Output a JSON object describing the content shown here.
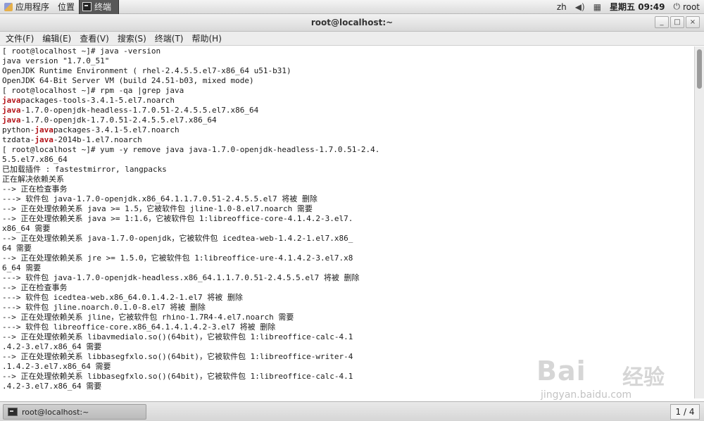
{
  "top_panel": {
    "applications": "应用程序",
    "places": "位置",
    "task_title": "终端",
    "input_method": "zh",
    "datetime": "星期五 09:49",
    "user": "root"
  },
  "window": {
    "title": "root@localhost:~",
    "minimize": "_",
    "maximize": "□",
    "close": "×"
  },
  "menu": [
    "文件(F)",
    "编辑(E)",
    "查看(V)",
    "搜索(S)",
    "终端(T)",
    "帮助(H)"
  ],
  "terminal": {
    "lines": [
      [
        {
          "t": "[ root@localhost ~]# java -version"
        }
      ],
      [
        {
          "t": "java version \"1.7.0_51\""
        }
      ],
      [
        {
          "t": "OpenJDK Runtime Environment ( rhel-2.4.5.5.el7-x86_64 u51-b31)"
        }
      ],
      [
        {
          "t": "OpenJDK 64-Bit Server VM (build 24.51-b03, mixed mode)"
        }
      ],
      [
        {
          "t": "[ root@localhost ~]# rpm -qa |grep java"
        }
      ],
      [
        {
          "t": "java",
          "h": true
        },
        {
          "t": "packages-tools-3.4.1-5.el7.noarch"
        }
      ],
      [
        {
          "t": "java",
          "h": true
        },
        {
          "t": "-1.7.0-openjdk-headless-1.7.0.51-2.4.5.5.el7.x86_64"
        }
      ],
      [
        {
          "t": "java",
          "h": true
        },
        {
          "t": "-1.7.0-openjdk-1.7.0.51-2.4.5.5.el7.x86_64"
        }
      ],
      [
        {
          "t": "python-"
        },
        {
          "t": "java",
          "h": true
        },
        {
          "t": "packages-3.4.1-5.el7.noarch"
        }
      ],
      [
        {
          "t": "tzdata-"
        },
        {
          "t": "java",
          "h": true
        },
        {
          "t": "-2014b-1.el7.noarch"
        }
      ],
      [
        {
          "t": "[ root@localhost ~]# yum -y remove java java-1.7.0-openjdk-headless-1.7.0.51-2.4."
        }
      ],
      [
        {
          "t": "5.5.el7.x86_64"
        }
      ],
      [
        {
          "t": "已加载插件 : fastestmirror, langpacks"
        }
      ],
      [
        {
          "t": "正在解决依赖关系"
        }
      ],
      [
        {
          "t": "--> 正在检查事务"
        }
      ],
      [
        {
          "t": "---> 软件包 java-1.7.0-openjdk.x86_64.1.1.7.0.51-2.4.5.5.el7 将被 删除"
        }
      ],
      [
        {
          "t": "--> 正在处理依赖关系 java >= 1.5，它被软件包 jline-1.0-8.el7.noarch 需要"
        }
      ],
      [
        {
          "t": "--> 正在处理依赖关系 java >= 1:1.6，它被软件包 1:libreoffice-core-4.1.4.2-3.el7."
        }
      ],
      [
        {
          "t": "x86_64 需要"
        }
      ],
      [
        {
          "t": "--> 正在处理依赖关系 java-1.7.0-openjdk，它被软件包 icedtea-web-1.4.2-1.el7.x86_"
        }
      ],
      [
        {
          "t": "64 需要"
        }
      ],
      [
        {
          "t": "--> 正在处理依赖关系 jre >= 1.5.0，它被软件包 1:libreoffice-ure-4.1.4.2-3.el7.x8"
        }
      ],
      [
        {
          "t": "6_64 需要"
        }
      ],
      [
        {
          "t": "---> 软件包 java-1.7.0-openjdk-headless.x86_64.1.1.7.0.51-2.4.5.5.el7 将被 删除"
        }
      ],
      [
        {
          "t": "--> 正在检查事务"
        }
      ],
      [
        {
          "t": "---> 软件包 icedtea-web.x86_64.0.1.4.2-1.el7 将被 删除"
        }
      ],
      [
        {
          "t": "---> 软件包 jline.noarch.0.1.0-8.el7 将被 删除"
        }
      ],
      [
        {
          "t": "--> 正在处理依赖关系 jline，它被软件包 rhino-1.7R4-4.el7.noarch 需要"
        }
      ],
      [
        {
          "t": "---> 软件包 libreoffice-core.x86_64.1.4.1.4.2-3.el7 将被 删除"
        }
      ],
      [
        {
          "t": "--> 正在处理依赖关系 libavmedialo.so()(64bit)，它被软件包 1:libreoffice-calc-4.1"
        }
      ],
      [
        {
          "t": ".4.2-3.el7.x86_64 需要"
        }
      ],
      [
        {
          "t": "--> 正在处理依赖关系 libbasegfxlo.so()(64bit)，它被软件包 1:libreoffice-writer-4"
        }
      ],
      [
        {
          "t": ".1.4.2-3.el7.x86_64 需要"
        }
      ],
      [
        {
          "t": "--> 正在处理依赖关系 libbasegfxlo.so()(64bit)，它被软件包 1:libreoffice-calc-4.1"
        }
      ],
      [
        {
          "t": ".4.2-3.el7.x86_64 需要"
        }
      ]
    ]
  },
  "bottom_panel": {
    "task_label": "root@localhost:~",
    "workspace": "1 / 4"
  },
  "watermark": {
    "logo": "Bai",
    "logo_cn": "经验",
    "url": "jingyan.baidu.com"
  },
  "colors": {
    "highlight": "#b3141a",
    "terminal_bg": "#ffffff",
    "terminal_fg": "#1a1a1a"
  }
}
